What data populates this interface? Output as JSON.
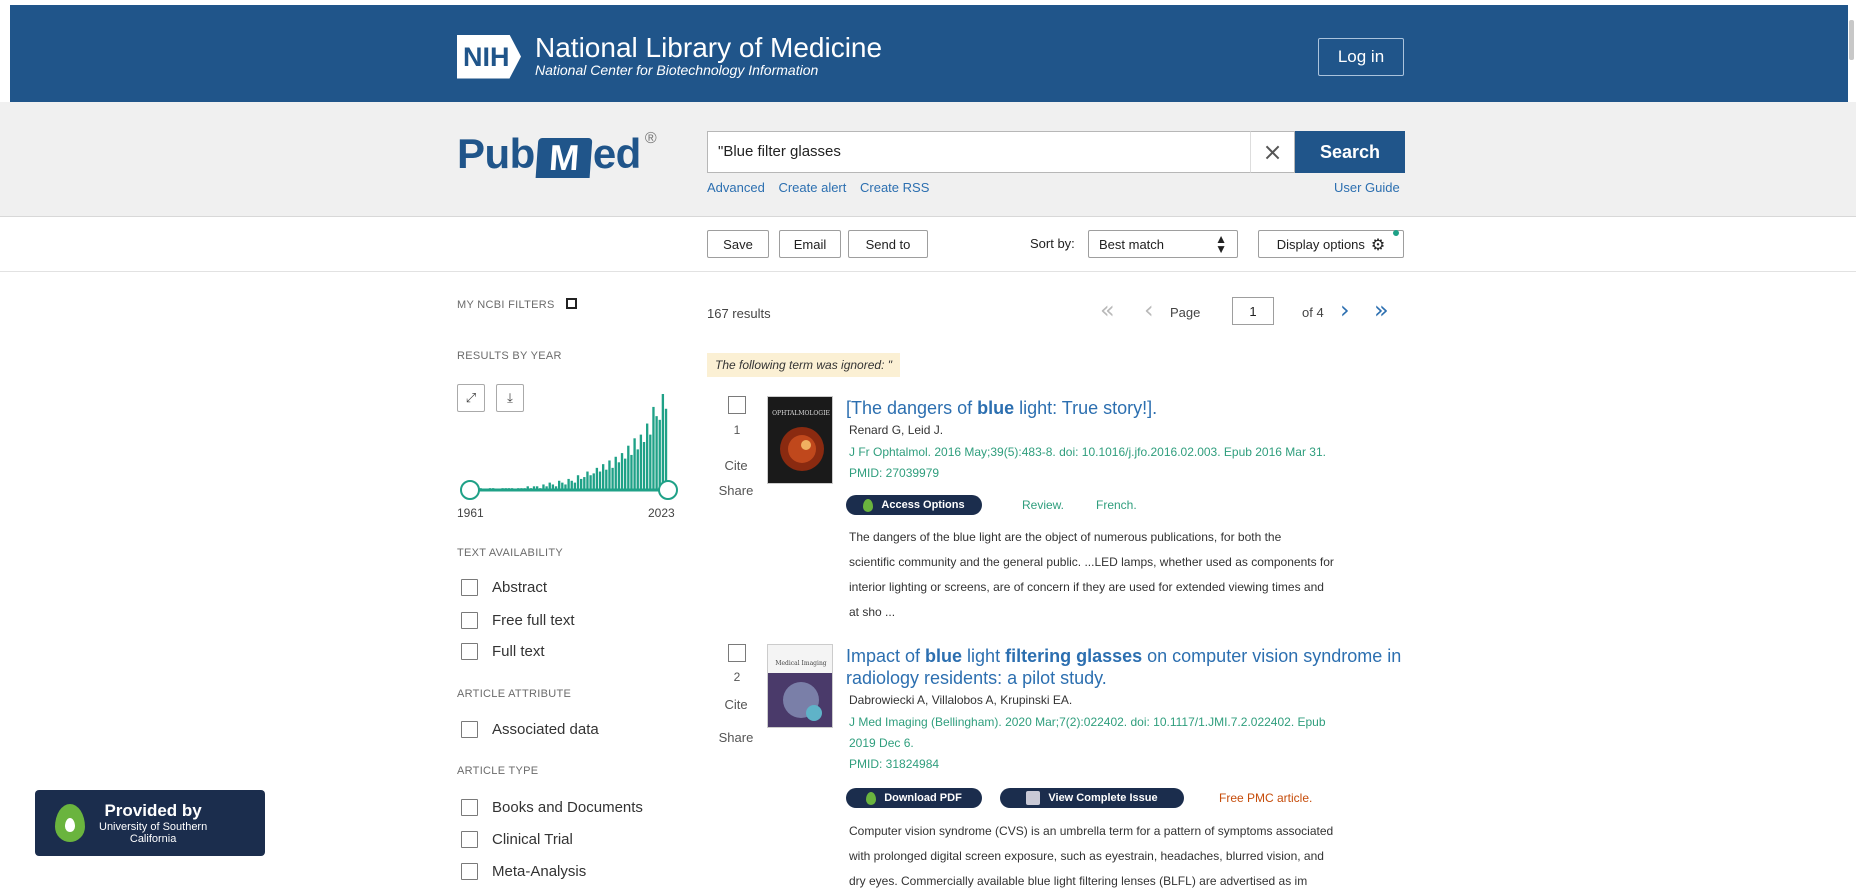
{
  "header": {
    "nih_badge": "NIH",
    "title": "National Library of Medicine",
    "subtitle": "National Center for Biotechnology Information",
    "login_label": "Log in"
  },
  "search": {
    "logo_pub": "Pub",
    "logo_med": "Med",
    "logo_reg": "®",
    "query": "\"Blue filter glasses",
    "clear_symbol": "×",
    "button_label": "Search",
    "links": [
      "Advanced",
      "Create alert",
      "Create RSS"
    ],
    "user_guide": "User Guide"
  },
  "toolbar": {
    "save": "Save",
    "email": "Email",
    "send_to": "Send to",
    "sort_label": "Sort by:",
    "sort_value": "Best match",
    "display_options": "Display options"
  },
  "sidebar": {
    "my_filters": "MY NCBI FILTERS",
    "results_by_year": "RESULTS BY YEAR",
    "year_start": "1961",
    "year_end": "2023",
    "text_availability": "TEXT AVAILABILITY",
    "text_filters": [
      "Abstract",
      "Free full text",
      "Full text"
    ],
    "article_attribute": "ARTICLE ATTRIBUTE",
    "attribute_filters": [
      "Associated data"
    ],
    "article_type": "ARTICLE TYPE",
    "type_filters": [
      "Books and Documents",
      "Clinical Trial",
      "Meta-Analysis"
    ]
  },
  "chart_data": {
    "type": "bar",
    "xlim": [
      "1961",
      "2023"
    ],
    "year_range": [
      "1961",
      "2023"
    ],
    "values": [
      1,
      0,
      0,
      1,
      0,
      0,
      1,
      1,
      0,
      0,
      1,
      1,
      1,
      1,
      0,
      1,
      1,
      1,
      2,
      1,
      2,
      2,
      1,
      3,
      2,
      4,
      3,
      2,
      5,
      4,
      3,
      6,
      5,
      4,
      8,
      6,
      7,
      10,
      8,
      9,
      12,
      10,
      14,
      11,
      16,
      12,
      18,
      15,
      20,
      17,
      24,
      19,
      28,
      22,
      30,
      26,
      36,
      30,
      45,
      40,
      38,
      52,
      44
    ],
    "color": "#1fa187"
  },
  "provided_by": {
    "line1": "Provided by",
    "line2": "University of Southern",
    "line3": "California"
  },
  "results": {
    "count": "167 results",
    "page_label": "Page",
    "page_value": "1",
    "of_pages": "of 4",
    "ignored_notice": "The following term was ignored: \"",
    "items": [
      {
        "num": "1",
        "title_pre": "[The dangers of ",
        "title_bold": "blue",
        "title_post": " light: True story!].",
        "authors": "Renard G, Leid J.",
        "citation": "J Fr Ophtalmol. 2016 May;39(5):483-8. doi: 10.1016/j.jfo.2016.02.003. Epub 2016 Mar 31.",
        "pmid": "PMID: 27039979",
        "button": "Access Options",
        "tags": [
          "Review.",
          "French."
        ],
        "snippet_lines": [
          "The dangers of the blue light are the object of numerous publications, for both the",
          "scientific community and the general public. ...LED lamps, whether used as components for",
          "interior lighting or screens, are of concern if they are used for extended viewing times and",
          "at sho ..."
        ],
        "thumb_label": "OPHTALMOLOGIE"
      },
      {
        "num": "2",
        "title_l1_pre": "Impact of ",
        "title_l1_b1": "blue",
        "title_l1_mid": " light ",
        "title_l1_b2": "filtering glasses",
        "title_l1_post": " on computer vision syndrome in",
        "title_l2": "radiology residents: a pilot study.",
        "authors": "Dabrowiecki A, Villalobos A, Krupinski EA.",
        "citation_l1": "J Med Imaging (Bellingham). 2020 Mar;7(2):022402. doi: 10.1117/1.JMI.7.2.022402. Epub",
        "citation_l2": "2019 Dec 6.",
        "pmid": "PMID: 31824984",
        "button1": "Download PDF",
        "button2": "View Complete Issue",
        "free": "Free PMC article.",
        "snippet_lines": [
          "Computer vision syndrome (CVS) is an umbrella term for a pattern of symptoms associated",
          "with prolonged digital screen exposure, such as eyestrain, headaches, blurred vision, and",
          "dry eyes. Commercially available blue light filtering lenses (BLFL) are advertised as im"
        ],
        "thumb_label": "Medical Imaging"
      }
    ],
    "cite": "Cite",
    "share": "Share"
  },
  "colors": {
    "header_bg": "#20558a",
    "link": "#2c6fb0",
    "chart": "#1fa187",
    "free_text": "#c64c0a",
    "pill_bg": "#1b2d4d"
  }
}
